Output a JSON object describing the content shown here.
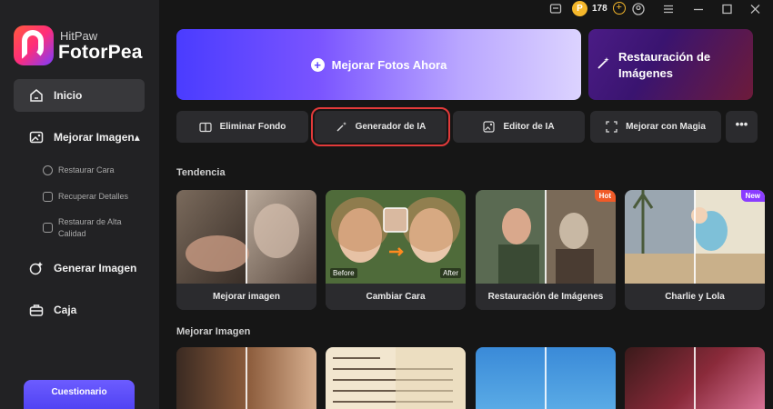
{
  "brand": {
    "top": "HitPaw",
    "name": "FotorPea"
  },
  "sidebar": {
    "nav": [
      {
        "label": "Inicio",
        "icon": "home-icon"
      },
      {
        "label": "Mejorar Imagen",
        "icon": "enhance-image-icon",
        "arrow": "▴"
      },
      {
        "label": "Generar Imagen",
        "icon": "generate-image-icon"
      },
      {
        "label": "Caja",
        "icon": "toolbox-icon"
      }
    ],
    "subitems": [
      {
        "label": "Restaurar Cara"
      },
      {
        "label": "Recuperar Detalles"
      },
      {
        "label": "Restaurar de Alta",
        "label2": "Calidad"
      }
    ],
    "quiz": "Cuestionario"
  },
  "topbar": {
    "credits": "178",
    "coin_symbol": "P",
    "plus": "+"
  },
  "hero": {
    "plus": "+",
    "label": "Mejorar Fotos Ahora"
  },
  "restore": {
    "label": "Restauración de Imágenes",
    "icon": "magic-wand-icon"
  },
  "tools": [
    {
      "label": "Eliminar Fondo",
      "icon": "eraser-icon"
    },
    {
      "label": "Generador de IA",
      "icon": "ai-wand-icon",
      "selected": true
    },
    {
      "label": "Editor de IA",
      "icon": "image-edit-icon"
    },
    {
      "label": "Mejorar con Magia",
      "icon": "expand-icon"
    }
  ],
  "more": "•••",
  "sections": {
    "trend": "Tendencia",
    "enhance": "Mejorar Imagen"
  },
  "cards": [
    {
      "caption": "Mejorar imagen"
    },
    {
      "caption": "Cambiar Cara",
      "before": "Before",
      "after": "After"
    },
    {
      "caption": "Restauración de Imágenes",
      "badge": "Hot"
    },
    {
      "caption": "Charlie y Lola",
      "badge": "New"
    }
  ],
  "colors": {
    "accent": "#5a45ff",
    "hot": "#f05a28",
    "new": "#8a3cff",
    "selected_outline": "#e23a3a"
  }
}
